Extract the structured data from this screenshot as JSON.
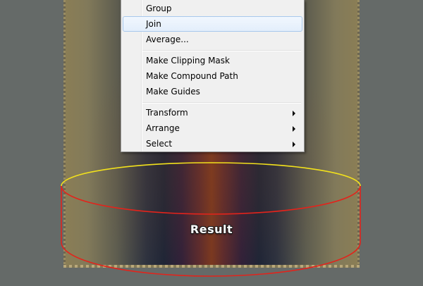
{
  "context_menu": {
    "items": [
      {
        "label": "Group",
        "submenu": false
      },
      {
        "label": "Join",
        "submenu": false,
        "highlighted": true
      },
      {
        "label": "Average...",
        "submenu": false
      },
      {
        "label": "Make Clipping Mask",
        "submenu": false
      },
      {
        "label": "Make Compound Path",
        "submenu": false
      },
      {
        "label": "Make Guides",
        "submenu": false
      },
      {
        "label": "Transform",
        "submenu": true
      },
      {
        "label": "Arrange",
        "submenu": true
      },
      {
        "label": "Select",
        "submenu": true
      }
    ]
  },
  "artwork": {
    "result_label": "Result",
    "colors": {
      "top_ellipse_stroke": "#f2e11c",
      "lower_shape_stroke": "#e3231b",
      "canvas_background": "#656a68"
    }
  }
}
